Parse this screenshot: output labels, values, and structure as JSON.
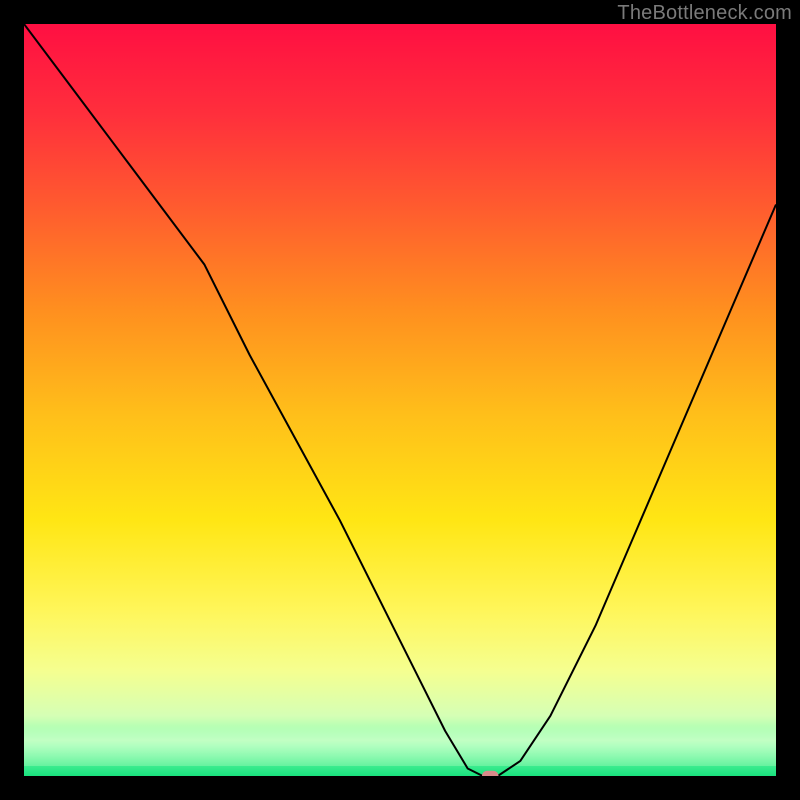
{
  "attribution": "TheBottleneck.com",
  "chart_data": {
    "type": "line",
    "title": "",
    "xlabel": "",
    "ylabel": "",
    "xlim": [
      0,
      100
    ],
    "ylim": [
      0,
      100
    ],
    "grid": false,
    "background_gradient": {
      "top": "#ff0f42",
      "middle": "#ffe614",
      "bottom": "#19e27e"
    },
    "series": [
      {
        "name": "bottleneck-curve",
        "color": "#000000",
        "x": [
          0,
          6,
          12,
          18,
          24,
          30,
          36,
          42,
          48,
          52,
          56,
          59,
          61,
          63,
          66,
          70,
          76,
          82,
          88,
          94,
          100
        ],
        "values": [
          100,
          92,
          84,
          76,
          68,
          56,
          45,
          34,
          22,
          14,
          6,
          1,
          0,
          0,
          2,
          8,
          20,
          34,
          48,
          62,
          76
        ]
      }
    ],
    "marker": {
      "name": "optimal-point",
      "x": 62,
      "y": 0,
      "color": "#d88a8a",
      "shape": "pill"
    }
  }
}
